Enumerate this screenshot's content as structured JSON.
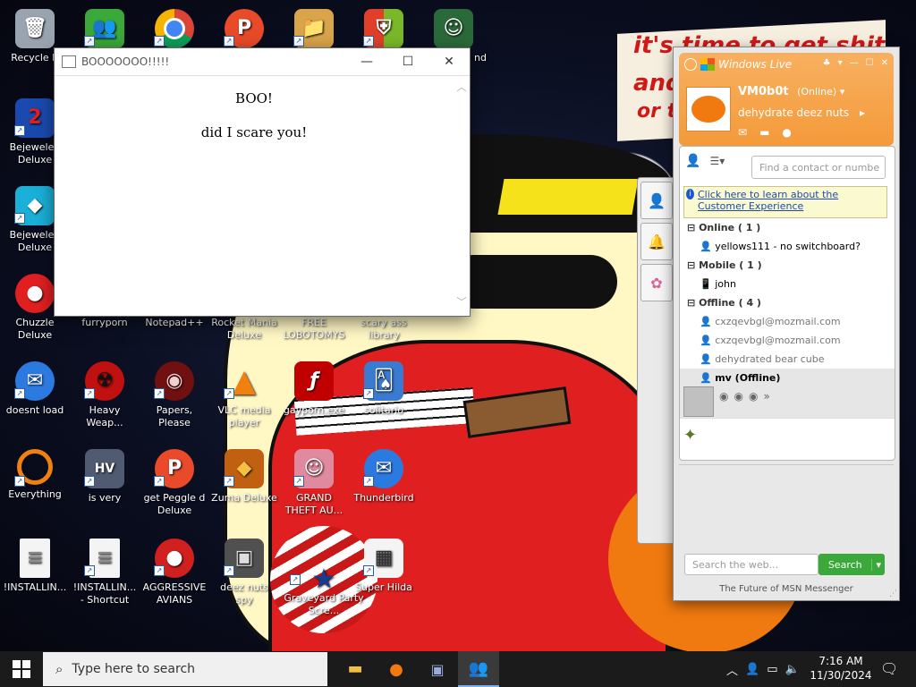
{
  "desktop": {
    "wallpaper_text": [
      "it's time to get shit",
      "and",
      "or t"
    ],
    "icons": [
      {
        "label": "Recycle B",
        "icon": "recycle-bin-icon",
        "color": "#9aa4b0",
        "glyph": "🗑"
      },
      {
        "label": "",
        "icon": "messenger-people-icon",
        "color": "#3aa83a",
        "glyph": "👥"
      },
      {
        "label": "",
        "icon": "chrome-icon",
        "color": "#4285f4",
        "glyph": "●"
      },
      {
        "label": "",
        "icon": "peggle-icon",
        "color": "#e84a2a",
        "glyph": "P"
      },
      {
        "label": "",
        "icon": "notepad-folder-icon",
        "color": "#d9a44a",
        "glyph": "📁"
      },
      {
        "label": "",
        "icon": "windows-shield-icon",
        "color": "#e0402a",
        "glyph": "⛨"
      },
      {
        "label": "nd",
        "icon": "anime-character-icon",
        "color": "#2a6a3a",
        "glyph": "☺"
      },
      {
        "label": "Bejeweled Deluxe",
        "icon": "bejeweled-2-icon",
        "color": "#1a4ab0",
        "glyph": "2"
      },
      {
        "label": "Bejeweled Deluxe",
        "icon": "bejeweled-gem-icon",
        "color": "#1ab0d8",
        "glyph": "◆"
      },
      {
        "label": "Chuzzle Deluxe",
        "icon": "chuzzle-icon",
        "color": "#e02020",
        "glyph": "●"
      },
      {
        "label": "furryporn",
        "icon": "generic-file-icon",
        "color": "#00000000",
        "glyph": ""
      },
      {
        "label": "Notepad++",
        "icon": "notepad-plus-icon",
        "color": "#00000000",
        "glyph": ""
      },
      {
        "label": "Rocket Mania Deluxe",
        "icon": "rocket-mania-icon",
        "color": "#00000000",
        "glyph": ""
      },
      {
        "label": "FREE LOBOTOMYS",
        "icon": "lobotomy-file-icon",
        "color": "#00000000",
        "glyph": ""
      },
      {
        "label": "scary ass library",
        "icon": "library-icon",
        "color": "#00000000",
        "glyph": ""
      },
      {
        "label": "doesnt load",
        "icon": "thunderbird-bird-icon",
        "color": "#2a7ae0",
        "glyph": "✉"
      },
      {
        "label": "Heavy Weap...",
        "icon": "radiation-icon",
        "color": "#c01010",
        "glyph": "☢"
      },
      {
        "label": "Papers, Please",
        "icon": "papers-please-icon",
        "color": "#701010",
        "glyph": "◉"
      },
      {
        "label": "VLC media player",
        "icon": "vlc-cone-icon",
        "color": "#f08010",
        "glyph": "▲"
      },
      {
        "label": "gayporn.exe",
        "icon": "flash-player-icon",
        "color": "#c00000",
        "glyph": "ƒ"
      },
      {
        "label": "solitario",
        "icon": "solitaire-cards-icon",
        "color": "#3a7ad0",
        "glyph": "🂡"
      },
      {
        "label": "Everything",
        "icon": "everything-search-icon",
        "color": "#f08010",
        "glyph": "○"
      },
      {
        "label": "is very",
        "icon": "heavy-weapon-tank-icon",
        "color": "#505a70",
        "glyph": "HV"
      },
      {
        "label": "get Peggle d Deluxe",
        "icon": "peggle-deluxe-icon",
        "color": "#e84a2a",
        "glyph": "P"
      },
      {
        "label": "Zuma Deluxe",
        "icon": "zuma-frog-icon",
        "color": "#c06010",
        "glyph": "◆"
      },
      {
        "label": "GRAND THEFT AU...",
        "icon": "anime-girl-icon",
        "color": "#e08aa0",
        "glyph": "☺"
      },
      {
        "label": "Thunderbird",
        "icon": "thunderbird-icon",
        "color": "#2a7ae0",
        "glyph": "✉"
      },
      {
        "label": "!INSTALLIN...",
        "icon": "text-document-icon",
        "color": "#f4f4f4",
        "glyph": "≡"
      },
      {
        "label": "!INSTALLIN... - Shortcut",
        "icon": "text-shortcut-icon",
        "color": "#f4f4f4",
        "glyph": "≡"
      },
      {
        "label": "AGGRESSIVE AVIANS",
        "icon": "angry-bird-icon",
        "color": "#d02020",
        "glyph": "●"
      },
      {
        "label": "deez nuts spy",
        "icon": "stacked-windows-icon",
        "color": "#505050",
        "glyph": "▣"
      },
      {
        "label": "Graveyard Party Scre...",
        "icon": "voted-sticker-icon",
        "color": "#ffffff",
        "glyph": "★"
      },
      {
        "label": "Super Hilda",
        "icon": "pixel-character-icon",
        "color": "#f4f4f4",
        "glyph": "▦"
      }
    ]
  },
  "boo_window": {
    "title": "BOOOOOOO!!!!!",
    "heading": "BOO!",
    "message": "did I scare you!",
    "min_glyph": "—",
    "max_glyph": "☐",
    "close_glyph": "✕"
  },
  "msn": {
    "brand": "Windows Live",
    "username": "VM0b0t",
    "status": "(Online)",
    "personal_message": "dehydrate deez nuts",
    "find_placeholder": "Find a contact or numbe",
    "info_text": "Click here to learn about the Customer Experience",
    "groups": [
      {
        "name": "Online ( 1 )",
        "contacts": [
          {
            "name": "yellows111 - no switchboard?",
            "state": "online"
          }
        ]
      },
      {
        "name": "Mobile ( 1 )",
        "contacts": [
          {
            "name": "john",
            "state": "mobile"
          }
        ]
      },
      {
        "name": "Offline ( 4 )",
        "contacts": [
          {
            "name": "cxzqevbgl@mozmail.com",
            "state": "offline"
          },
          {
            "name": "cxzqevbgl@mozmail.com",
            "state": "offline"
          },
          {
            "name": "dehydrated bear cube",
            "state": "offline"
          },
          {
            "name": "mv  (Offline)",
            "state": "selected"
          }
        ]
      }
    ],
    "expand_glyph": "»",
    "search_placeholder": "Search the web...",
    "search_button": "Search",
    "footer": "The Future of MSN Messenger"
  },
  "taskbar": {
    "search_placeholder": "Type here to search",
    "time": "7:16 AM",
    "date": "11/30/2024"
  }
}
